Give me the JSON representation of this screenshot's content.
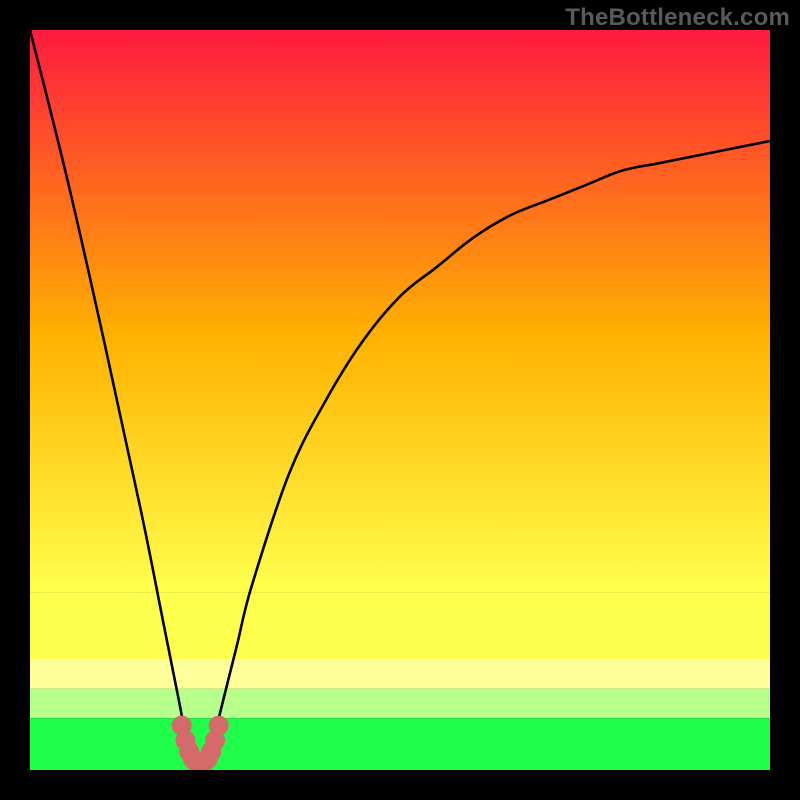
{
  "watermark": {
    "text": "TheBottleneck.com"
  },
  "colors": {
    "band_top": "#ff1a3f",
    "band_mid": "#ffb300",
    "band_yellow": "#ffff4d",
    "band_paleyell": "#ffff99",
    "band_palegr": "#b6ff8a",
    "band_green": "#1fff4a",
    "curve": "#000000",
    "marker": "#d46a6a"
  },
  "chart_data": {
    "type": "line",
    "title": "",
    "xlabel": "",
    "ylabel": "",
    "xlim": [
      0,
      100
    ],
    "ylim": [
      0,
      100
    ],
    "note": "V-shaped bottleneck curve; valley ≈ x=23 where y≈0. y-values are visual estimates (% of plot height).",
    "series": [
      {
        "name": "bottleneck-curve",
        "x": [
          0,
          5,
          10,
          15,
          18,
          20,
          21,
          22,
          23,
          24,
          25,
          26,
          28,
          30,
          35,
          40,
          45,
          50,
          55,
          60,
          65,
          70,
          75,
          80,
          85,
          90,
          95,
          100
        ],
        "values": [
          100,
          80,
          58,
          35,
          20,
          10,
          5,
          2,
          0,
          2,
          5,
          9,
          17,
          25,
          40,
          50,
          58,
          64,
          68,
          72,
          75,
          77,
          79,
          81,
          82,
          83,
          84,
          85
        ]
      }
    ],
    "markers": {
      "name": "valley-marker",
      "x": [
        20.5,
        21.0,
        21.5,
        22.0,
        22.5,
        23.0,
        23.5,
        24.0,
        24.5,
        25.0,
        25.5
      ],
      "values": [
        6.0,
        4.0,
        2.5,
        1.5,
        1.0,
        1.0,
        1.0,
        1.5,
        2.5,
        4.0,
        6.0
      ]
    },
    "background_bands": [
      {
        "from_y": 100,
        "to_y": 24,
        "gradient": [
          "#ff1a3f",
          "#ffb300",
          "#ffff4d"
        ]
      },
      {
        "from_y": 24,
        "to_y": 15,
        "color": "#ffff4d"
      },
      {
        "from_y": 15,
        "to_y": 11,
        "color": "#ffff99"
      },
      {
        "from_y": 11,
        "to_y": 7,
        "color": "#b6ff8a"
      },
      {
        "from_y": 7,
        "to_y": 0,
        "color": "#1fff4a"
      }
    ]
  }
}
